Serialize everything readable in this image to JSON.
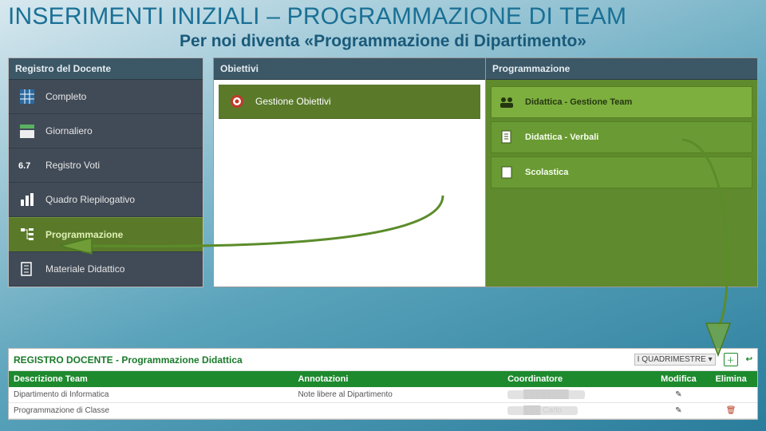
{
  "title": "INSERIMENTI INIZIALI – PROGRAMMAZIONE DI TEAM",
  "subtitle": "Per noi diventa «Programmazione di Dipartimento»",
  "panel1": {
    "header": "Registro del Docente",
    "items": [
      {
        "label": "Completo",
        "icon": "grid"
      },
      {
        "label": "Giornaliero",
        "icon": "rows"
      },
      {
        "label": "Registro Voti",
        "icon": "score"
      },
      {
        "label": "Quadro Riepilogativo",
        "icon": "bars"
      },
      {
        "label": "Programmazione",
        "icon": "tree",
        "hl": true
      },
      {
        "label": "Materiale Didattico",
        "icon": "doc"
      }
    ]
  },
  "panel2": {
    "header": "Obiettivi",
    "items": [
      {
        "label": "Gestione Obiettivi",
        "icon": "target"
      }
    ]
  },
  "panel3": {
    "header": "Programmazione",
    "items": [
      {
        "label": "Didattica - Gestione Team",
        "icon": "team",
        "bright": true
      },
      {
        "label": "Didattica - Verbali",
        "icon": "docs"
      },
      {
        "label": "Scolastica",
        "icon": "file"
      }
    ]
  },
  "bottom": {
    "title": "REGISTRO DOCENTE - Programmazione Didattica",
    "period": "I QUADRIMESTRE",
    "cols": {
      "desc": "Descrizione Team",
      "ann": "Annotazioni",
      "coord": "Coordinatore",
      "mod": "Modifica",
      "del": "Elimina"
    },
    "rows": [
      {
        "desc": "Dipartimento di Informatica",
        "ann": "Note libere al Dipartimento",
        "coord": "████████",
        "mod": "✎",
        "del": ""
      },
      {
        "desc": "Programmazione di Classe",
        "ann": "",
        "coord": "███ Carlo",
        "mod": "✎",
        "del": "🗑"
      }
    ]
  }
}
